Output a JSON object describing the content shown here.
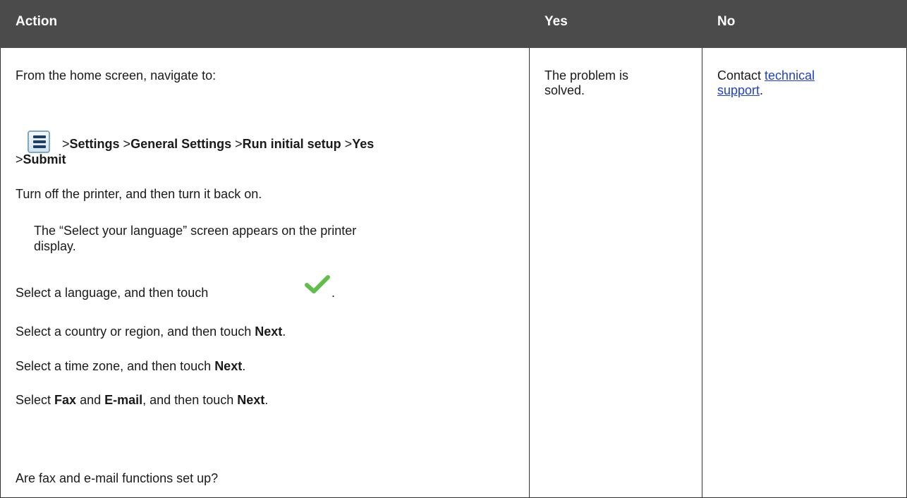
{
  "table": {
    "headers": {
      "action": "Action",
      "yes": "Yes",
      "no": "No"
    },
    "action": {
      "step1_intro": "From the home screen, navigate to:",
      "menu_path": {
        "sep": ">",
        "settings": "Settings",
        "general_settings": "General Settings",
        "run_initial_setup": "Run initial setup",
        "yes": "Yes",
        "submit": "Submit"
      },
      "step2": "Turn off the printer, and then turn it back on.",
      "step2_note_line1": "The “Select your language” screen appears on the printer",
      "step2_note_line2": "display.",
      "step3": "Select a language, and then touch",
      "step3_end": ".",
      "step4_pre": "Select a country or region, and then touch ",
      "step4_bold": "Next",
      "step4_end": ".",
      "step5_pre": "Select a time zone, and then touch ",
      "step5_bold": "Next",
      "step5_end": ".",
      "step6_pre": "Select ",
      "step6_fax": "Fax",
      "step6_and": " and ",
      "step6_email": "E-mail",
      "step6_mid": ", and then touch ",
      "step6_next": "Next",
      "step6_end": ".",
      "question": "Are fax and e-mail functions set up?"
    },
    "yes_cell": {
      "line1": "The problem is",
      "line2": "solved."
    },
    "no_cell": {
      "contact": "Contact ",
      "link_line1": "technical",
      "link_line2": "support",
      "end": "."
    }
  },
  "icons": {
    "menu": "menu-list-icon",
    "confirm": "green-check-icon"
  }
}
